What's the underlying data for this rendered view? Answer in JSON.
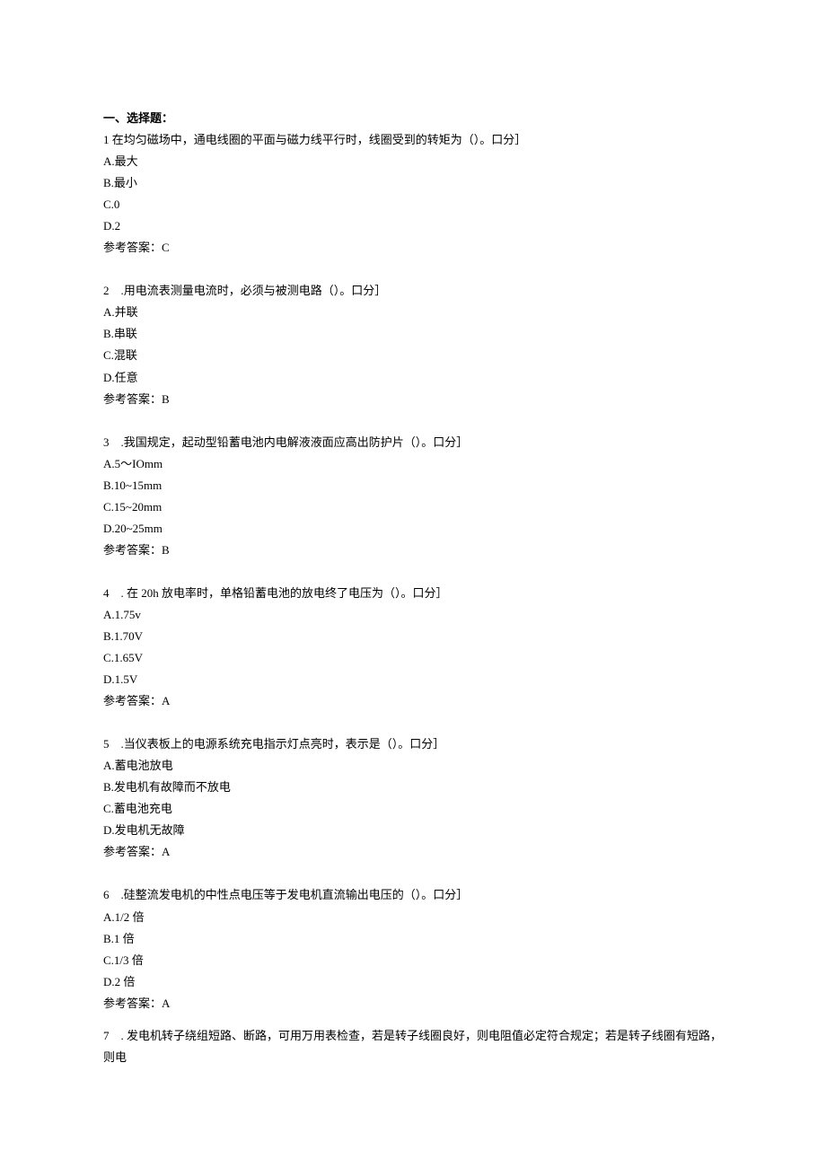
{
  "sectionTitle": "一、选择题：",
  "questions": [
    {
      "text": "1 在均匀磁场中，通电线圈的平面与磁力线平行时，线圈受到的转矩为（）。口分］",
      "options": [
        "A.最大",
        "B.最小",
        "C.0",
        "D.2"
      ],
      "answer": "参考答案：C"
    },
    {
      "text": "2　.用电流表测量电流时，必须与被测电路（）。口分］",
      "options": [
        "A.并联",
        "B.串联",
        "C.混联",
        "D.任意"
      ],
      "answer": "参考答案：B"
    },
    {
      "text": "3　.我国规定，起动型铅蓄电池内电解液液面应高出防护片（）。口分］",
      "options": [
        "A.5～IOmm",
        "B.10~15mm",
        "C.15~20mm",
        "D.20~25mm"
      ],
      "answer": "参考答案：B"
    },
    {
      "text": "4　. 在 20h 放电率时，单格铅蓄电池的放电终了电压为（）。口分］",
      "options": [
        "A.1.75v",
        "B.1.70V",
        "C.1.65V",
        "D.1.5V"
      ],
      "answer": "参考答案：A"
    },
    {
      "text": "5　.当仪表板上的电源系统充电指示灯点亮时，表示是（）。口分］",
      "options": [
        "A.蓄电池放电",
        "B.发电机有故障而不放电",
        "C.蓄电池充电",
        "D.发电机无故障"
      ],
      "answer": "参考答案：A"
    },
    {
      "text": "6　.硅整流发电机的中性点电压等于发电机直流输出电压的（）。口分］",
      "options": [
        "A.1/2 倍",
        "B.1 倍",
        "C.1/3 倍",
        "D.2 倍"
      ],
      "answer": "参考答案：A"
    },
    {
      "text": "7　. 发电机转子绕组短路、断路，可用万用表检查，若是转子线圈良好，则电阻值必定符合规定；若是转子线圈有短路，则电",
      "options": [],
      "answer": null
    }
  ]
}
